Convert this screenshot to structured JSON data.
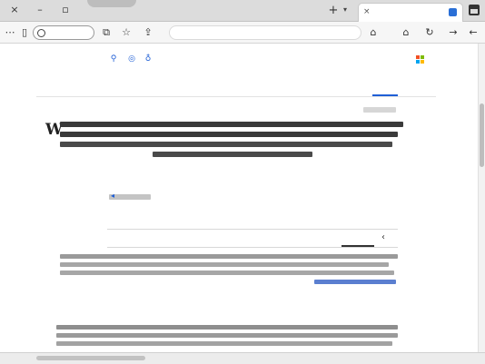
{
  "window": {
    "minimize_icon": "minimize-icon",
    "maximize_icon": "maximize-icon"
  },
  "tabs": {
    "active_title": "",
    "new_tab_icon": "plus-icon",
    "menu_icon": "chevron-down-icon"
  },
  "toolbar": {
    "profile_pill_label": "",
    "url": "",
    "icons": [
      "menu-dots-icon",
      "profile-icon",
      "collections-icon",
      "favorites-icon",
      "share-icon",
      "bookmark-icon",
      "extensions-icon",
      "refresh-icon",
      "back-icon"
    ]
  },
  "search": {
    "brand_label": "",
    "query": "",
    "icons": [
      "search-icon",
      "camera-icon",
      "mic-icon"
    ],
    "nav_tabs": [
      "",
      "",
      "",
      "",
      ""
    ]
  },
  "wiki_panel": {
    "caption": ""
  },
  "results": {
    "r1_title": "",
    "r1_url": "",
    "r2_title": "",
    "r2_url": "",
    "sub_tabs": [
      "",
      "",
      "",
      "",
      ""
    ],
    "r3_title": "",
    "r3_url": ""
  },
  "colors": {
    "link_blue": "#1f4fc4",
    "url_green": "#1b7a33",
    "accent_blue": "#1f5fd6",
    "tab_bar": "#dcdcdc"
  }
}
